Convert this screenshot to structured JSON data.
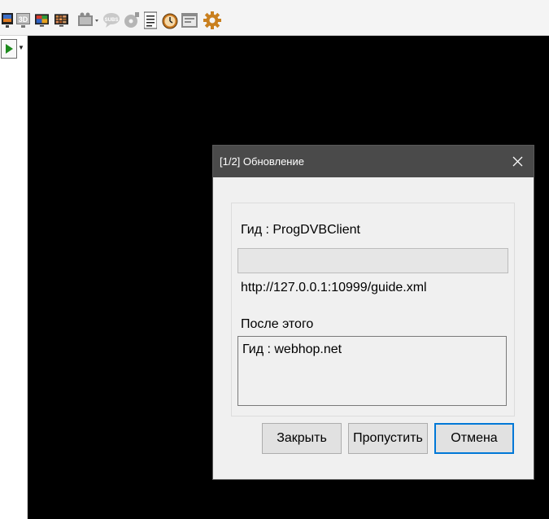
{
  "toolbar": {
    "icons": [
      "monitor-icon",
      "3d-icon",
      "monitor-image-icon",
      "mosaic-icon",
      "film-icon",
      "subtitles-icon",
      "disc-icon",
      "document-icon",
      "clock-icon",
      "window-icon",
      "gear-icon"
    ]
  },
  "dialog": {
    "title": "[1/2] Обновление",
    "guide_label": "Гид : ProgDVBClient",
    "progress_value": 0,
    "url": "http://127.0.0.1:10999/guide.xml",
    "after_label": "После этого",
    "queue": [
      "Гид : webhop.net"
    ],
    "buttons": {
      "close": "Закрыть",
      "skip": "Пропустить",
      "cancel": "Отмена"
    }
  }
}
